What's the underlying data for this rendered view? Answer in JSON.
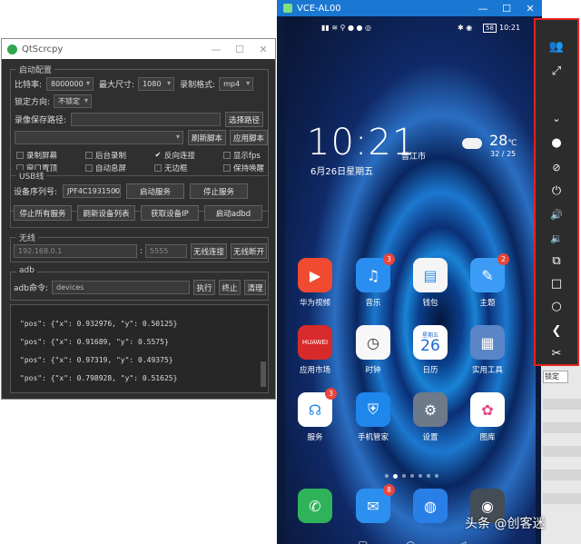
{
  "qt": {
    "title": "QtScrcpy",
    "config": {
      "group_title": "启动配置",
      "bitrate_label": "比特率:",
      "bitrate_value": "8000000",
      "maxsize_label": "最大尺寸:",
      "maxsize_value": "1080",
      "format_label": "录制格式:",
      "format_value": "mp4",
      "lock_label": "锁定方向:",
      "lock_value": "不锁定",
      "record_path_label": "录像保存路径:",
      "select_path_btn": "选择路径",
      "refresh_script_btn": "刷新脚本",
      "apply_script_btn": "应用脚本",
      "checkboxes": [
        {
          "label": "录制屏幕",
          "checked": false
        },
        {
          "label": "后台录制",
          "checked": false
        },
        {
          "label": "反向连接",
          "checked": true
        },
        {
          "label": "显示fps",
          "checked": false
        },
        {
          "label": "窗口置顶",
          "checked": false
        },
        {
          "label": "自动息屏",
          "checked": false
        },
        {
          "label": "无边框",
          "checked": false
        },
        {
          "label": "保持唤醒",
          "checked": false
        }
      ]
    },
    "usb": {
      "group_title": "USB线",
      "serial_label": "设备序列号:",
      "serial_value": "JPF4C1931500",
      "start_service_btn": "启动服务",
      "stop_service_btn": "停止服务",
      "stop_all_btn": "停止所有服务",
      "refresh_devices_btn": "刷新设备列表",
      "get_ip_btn": "获取设备IP",
      "start_adbd_btn": "启动adbd"
    },
    "wireless": {
      "group_title": "无线",
      "ip_value": "192.168.0.1",
      "port_value": "5555",
      "connect_btn": "无线连接",
      "disconnect_btn": "无线断开"
    },
    "adb": {
      "group_title": "adb",
      "cmd_label": "adb命令:",
      "cmd_value": "devices",
      "exec_btn": "执行",
      "stop_btn": "终止",
      "clear_btn": "清理"
    },
    "log": [
      "\"pos\": {\"x\": 0.932976, \"y\": 0.50125}",
      "\"pos\": {\"x\": 0.91689, \"y\": 0.5575}",
      "\"pos\": {\"x\": 0.97319, \"y\": 0.49375}",
      "\"pos\": {\"x\": 0.798928, \"y\": 0.51625}"
    ]
  },
  "phone": {
    "title": "VCE-AL00",
    "status_right": "10:21",
    "battery": "58",
    "clock": "10:21",
    "date": "6月26日星期五",
    "city": "晋江市",
    "temp": "28",
    "temp_unit": "℃",
    "temp_range": "32 / 25",
    "apps": [
      {
        "name": "华为视频",
        "icon": "video-icon",
        "color": "#f04a30",
        "badge": ""
      },
      {
        "name": "音乐",
        "icon": "music-icon",
        "color": "#2a8ef0",
        "badge": "3"
      },
      {
        "name": "钱包",
        "icon": "wallet-icon",
        "color": "#f5f5f5",
        "badge": ""
      },
      {
        "name": "主题",
        "icon": "theme-icon",
        "color": "#3c9cf5",
        "badge": "2"
      },
      {
        "name": "应用市场",
        "icon": "appgallery-icon",
        "color": "#d82a2a",
        "badge": ""
      },
      {
        "name": "时钟",
        "icon": "clock-icon",
        "color": "#f7f7f7",
        "badge": ""
      },
      {
        "name": "日历",
        "icon": "calendar-icon",
        "color": "#ffffff",
        "badge": ""
      },
      {
        "name": "实用工具",
        "icon": "tools-icon",
        "color": "#5a86c8",
        "badge": ""
      },
      {
        "name": "服务",
        "icon": "service-icon",
        "color": "#ffffff",
        "badge": "3"
      },
      {
        "name": "手机管家",
        "icon": "shield-icon",
        "color": "#1f86ec",
        "badge": ""
      },
      {
        "name": "设置",
        "icon": "settings-icon",
        "color": "#6d7a8a",
        "badge": ""
      },
      {
        "name": "图库",
        "icon": "gallery-icon",
        "color": "#ffffff",
        "badge": ""
      }
    ],
    "calendar_day": "26",
    "calendar_weekday": "星期五",
    "appgallery_label": "HUAWEI",
    "dock": [
      {
        "icon": "phone-icon",
        "color": "#2fb35a",
        "badge": ""
      },
      {
        "icon": "message-icon",
        "color": "#2c8ff0",
        "badge": "8"
      },
      {
        "icon": "browser-icon",
        "color": "#2a7fe6",
        "badge": ""
      },
      {
        "icon": "camera-icon",
        "color": "#444c55",
        "badge": ""
      }
    ]
  },
  "toolbar": {
    "accent": "#e52222",
    "buttons": [
      "group-icon",
      "fullscreen-icon",
      "expand-icon",
      "record-icon",
      "eye-off-icon",
      "power-icon",
      "volume-up-icon",
      "volume-down-icon",
      "rotate-icon",
      "home-icon",
      "circle-icon",
      "back-icon",
      "scissors-icon"
    ]
  },
  "right_edge": {
    "combo_value": "锁定"
  },
  "watermark": "头条 @创客迷"
}
